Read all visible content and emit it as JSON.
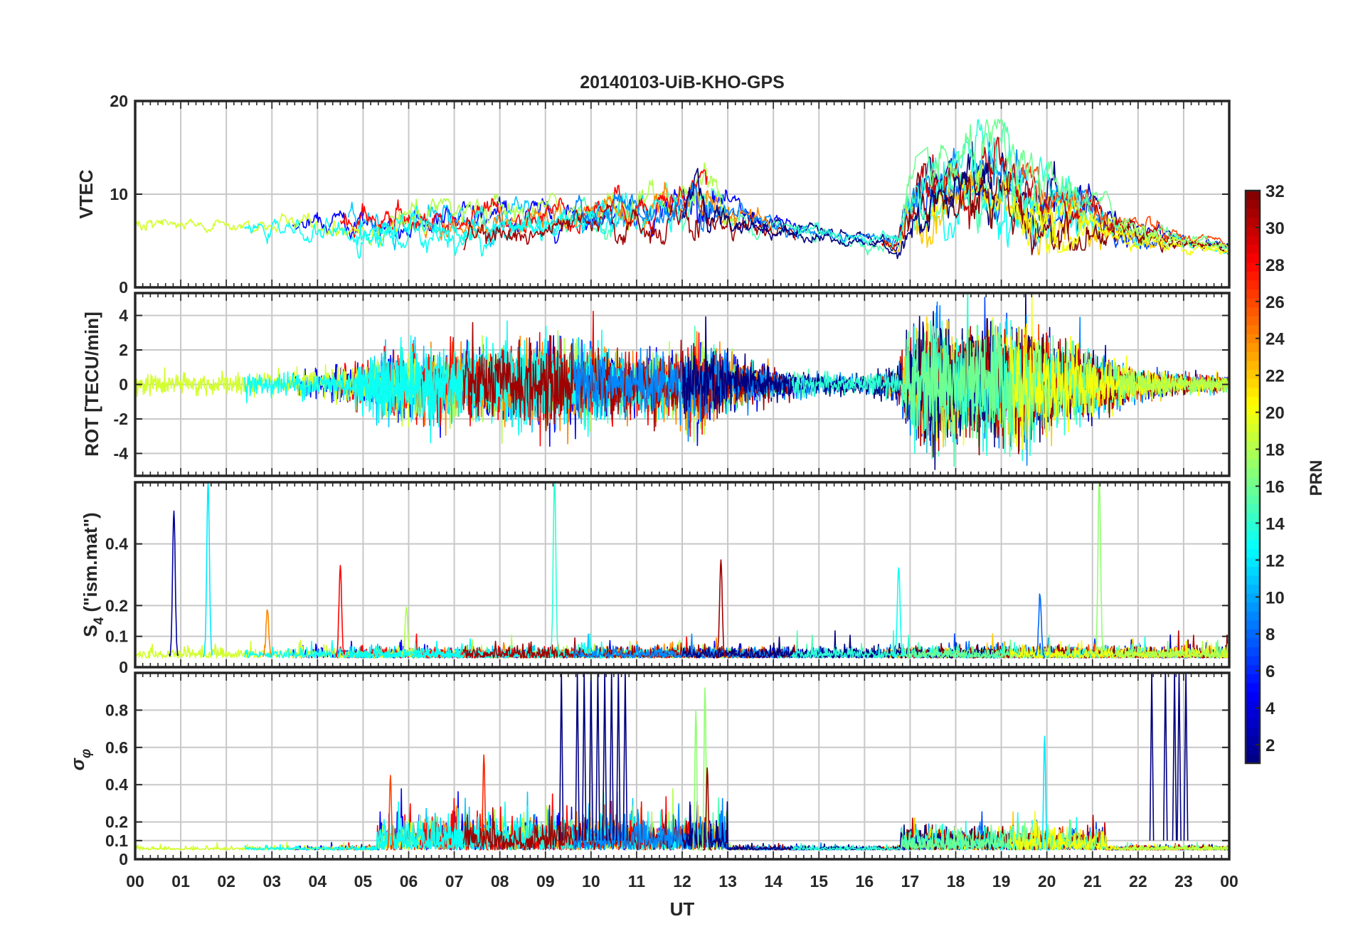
{
  "chart_data": {
    "type": "line",
    "title": "20140103-UiB-KHO-GPS",
    "xlabel": "UT",
    "x_ticks": [
      "00",
      "01",
      "02",
      "03",
      "04",
      "05",
      "06",
      "07",
      "08",
      "09",
      "10",
      "11",
      "12",
      "13",
      "14",
      "15",
      "16",
      "17",
      "18",
      "19",
      "20",
      "21",
      "22",
      "23",
      "00"
    ],
    "xlim": [
      0,
      24
    ],
    "grid": true,
    "colorbar": {
      "label": "PRN",
      "range": [
        1,
        32
      ],
      "ticks": [
        "2",
        "4",
        "6",
        "8",
        "10",
        "12",
        "14",
        "16",
        "18",
        "20",
        "22",
        "24",
        "26",
        "28",
        "30",
        "32"
      ],
      "colormap": "jet",
      "placement": "right"
    },
    "panels": [
      {
        "ylabel": "VTEC",
        "ylim": [
          0,
          20
        ],
        "yticks": [
          "0",
          "10",
          "20"
        ],
        "envelope": {
          "hours": [
            0,
            1,
            2,
            3,
            4,
            5,
            6,
            7,
            8,
            9,
            10,
            11,
            12,
            12.5,
            13,
            14,
            15,
            16,
            16.7,
            17,
            17.5,
            18,
            18.5,
            19,
            19.5,
            20,
            20.5,
            21,
            21.5,
            22,
            23,
            24
          ],
          "low": [
            4,
            4.5,
            5,
            5,
            4.5,
            3.5,
            3.5,
            3.5,
            4,
            4.5,
            5,
            5,
            5,
            5,
            5.5,
            5,
            4.5,
            4,
            3,
            4,
            5,
            6,
            6,
            5,
            4,
            4,
            4.5,
            4.5,
            4.5,
            4,
            4,
            3.5
          ],
          "high": [
            8,
            7.5,
            7.5,
            8,
            8,
            9,
            9,
            9,
            9.5,
            9.5,
            10,
            11,
            12,
            14,
            10,
            8,
            7,
            6,
            6,
            13,
            15,
            16,
            17.5,
            17.5,
            15,
            13,
            13,
            11,
            9,
            8,
            6,
            5
          ]
        }
      },
      {
        "ylabel": "ROT [TECU/min]",
        "ylim": [
          -5.3,
          5.3
        ],
        "yticks": [
          "-4",
          "-2",
          "0",
          "2",
          "4"
        ],
        "envelope": {
          "hours": [
            0,
            1,
            2,
            3,
            4,
            5,
            5.5,
            6,
            7,
            8,
            9,
            10,
            11,
            12,
            12.5,
            13,
            14,
            15,
            16,
            16.7,
            17,
            17.5,
            18,
            19,
            19.5,
            20,
            20.5,
            21,
            22,
            23,
            24
          ],
          "amp": [
            0.8,
            0.8,
            0.8,
            0.8,
            1,
            1.5,
            2.5,
            2.5,
            2.5,
            2.5,
            3,
            2.5,
            2,
            2.5,
            3,
            2,
            1,
            0.7,
            0.6,
            1,
            3,
            4.5,
            3.5,
            4,
            4,
            3,
            2.5,
            2,
            1,
            0.6,
            0.5
          ]
        }
      },
      {
        "ylabel": "S4 (\"ism.mat\")",
        "ylabel_main": "S",
        "ylabel_sub": "4",
        "ylabel_rest": " (\"ism.mat\")",
        "ylim": [
          0,
          0.6
        ],
        "yticks": [
          "0",
          "0.1",
          "0.2",
          "0.4"
        ],
        "baseline": 0.03,
        "spikes": [
          {
            "x": 0.85,
            "y": 0.5,
            "prn": 2
          },
          {
            "x": 1.6,
            "y": 0.6,
            "prn": 12
          },
          {
            "x": 2.9,
            "y": 0.18,
            "prn": 24
          },
          {
            "x": 4.5,
            "y": 0.32,
            "prn": 28
          },
          {
            "x": 5.95,
            "y": 0.19,
            "prn": 18
          },
          {
            "x": 9.2,
            "y": 0.6,
            "prn": 14
          },
          {
            "x": 12.85,
            "y": 0.34,
            "prn": 31
          },
          {
            "x": 16.75,
            "y": 0.32,
            "prn": 13
          },
          {
            "x": 19.85,
            "y": 0.23,
            "prn": 8
          },
          {
            "x": 21.15,
            "y": 0.6,
            "prn": 17
          }
        ]
      },
      {
        "ylabel": "σφ",
        "ylabel_main": "σ",
        "ylabel_sub": "φ",
        "ylim": [
          0,
          1
        ],
        "yticks": [
          "0",
          "0.1",
          "0.2",
          "0.4",
          "0.6",
          "0.8"
        ],
        "baseline": 0.05,
        "spikes": [
          {
            "x": 5.6,
            "y": 0.45,
            "prn": 26
          },
          {
            "x": 7.65,
            "y": 0.56,
            "prn": 27
          },
          {
            "x": 12.3,
            "y": 0.8,
            "prn": 17
          },
          {
            "x": 12.5,
            "y": 0.92,
            "prn": 17
          },
          {
            "x": 12.55,
            "y": 0.49,
            "prn": 31
          },
          {
            "x": 19.95,
            "y": 0.66,
            "prn": 12
          }
        ],
        "prn1_burst_hours": [
          9.35,
          9.7,
          9.85,
          10.0,
          10.15,
          10.3,
          10.45,
          10.6,
          10.75,
          22.3,
          22.6,
          22.8,
          22.9,
          23.05
        ]
      }
    ]
  }
}
